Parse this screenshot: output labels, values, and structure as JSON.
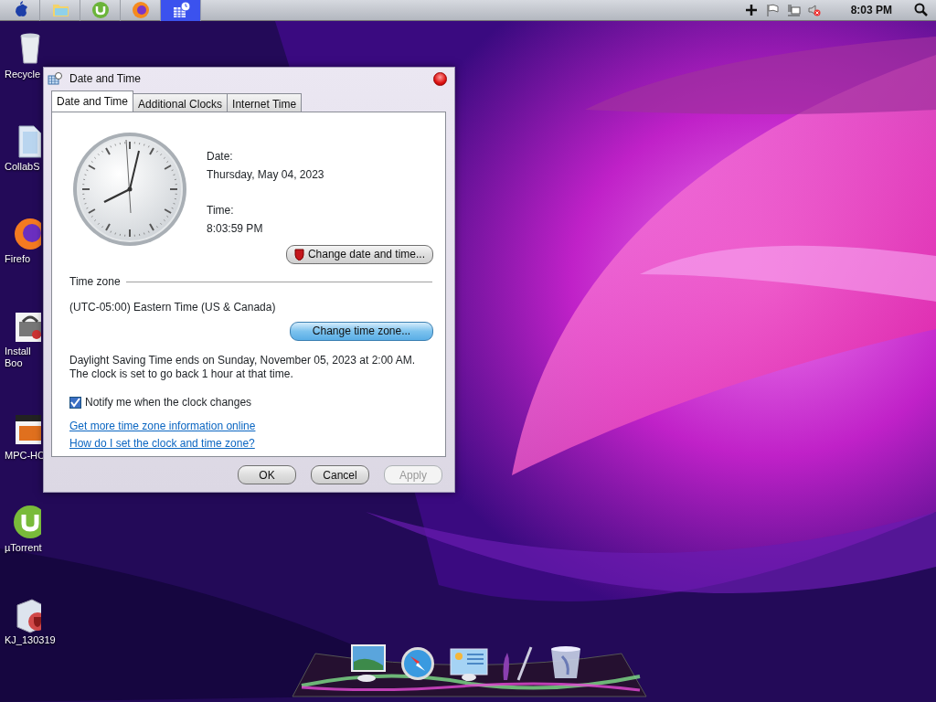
{
  "top_bar": {
    "apps": [
      {
        "kind": "apple",
        "selected": false
      },
      {
        "kind": "folder",
        "selected": false
      },
      {
        "kind": "utorrent",
        "selected": false
      },
      {
        "kind": "firefox",
        "selected": false
      },
      {
        "kind": "datetime",
        "selected": true
      }
    ],
    "tray": [
      {
        "kind": "plus"
      },
      {
        "kind": "flag"
      },
      {
        "kind": "network"
      },
      {
        "kind": "volume-muted"
      }
    ],
    "clock": "8:03 PM"
  },
  "desktop_icons": [
    {
      "kind": "recycle",
      "lines": [
        "Recycle"
      ]
    },
    {
      "kind": "folder",
      "lines": [
        "CollabS"
      ]
    },
    {
      "kind": "firefox",
      "lines": [
        "Firefo"
      ]
    },
    {
      "kind": "installer",
      "lines": [
        "Install",
        "Boo"
      ]
    },
    {
      "kind": "media",
      "lines": [
        "MPC-HC"
      ]
    },
    {
      "kind": "utorrent",
      "lines": [
        "µTorrent"
      ]
    },
    {
      "kind": "package",
      "lines": [
        "KJ_130319"
      ]
    }
  ],
  "dialog": {
    "title": "Date and Time",
    "tabs": [
      {
        "label": "Date and Time",
        "selected": true
      },
      {
        "label": "Additional Clocks",
        "selected": false
      },
      {
        "label": "Internet Time",
        "selected": false
      }
    ],
    "date_label": "Date:",
    "date": "Thursday, May 04, 2023",
    "time_label": "Time:",
    "time": "8:03:59 PM",
    "change_date_button": "Change date and time...",
    "time_zone_heading": "Time zone",
    "time_zone": "(UTC-05:00) Eastern Time (US & Canada)",
    "change_zone_button": "Change time zone...",
    "dst_text": "Daylight Saving Time ends on Sunday, November 05, 2023 at 2:00 AM. The clock is set to go back 1 hour at that time.",
    "notify": {
      "label": "Notify me when the clock changes",
      "checked": true
    },
    "links": [
      "Get more time zone information online",
      "How do I set the clock and time zone?"
    ],
    "buttons": [
      {
        "label": "OK",
        "disabled": false
      },
      {
        "label": "Cancel",
        "disabled": false
      },
      {
        "label": "Apply",
        "disabled": true
      }
    ]
  },
  "dock": [
    {
      "kind": "monitor"
    },
    {
      "kind": "compass"
    },
    {
      "kind": "panel"
    },
    {
      "kind": "brush"
    },
    {
      "kind": "trash"
    }
  ]
}
